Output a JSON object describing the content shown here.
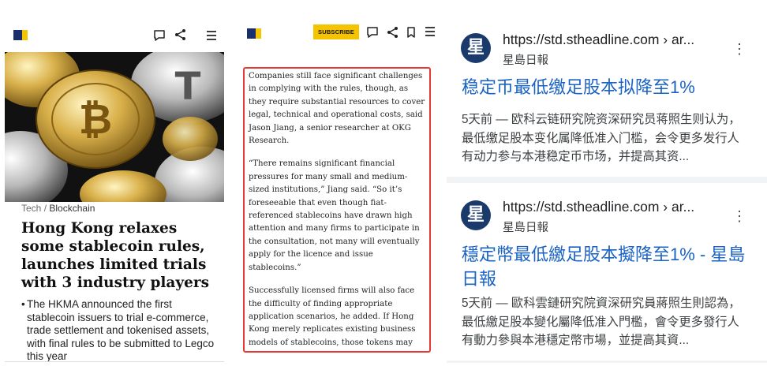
{
  "panel1": {
    "category": "Tech",
    "category_sep": " / ",
    "subcategory": "Blockchain",
    "headline": "Hong Kong relaxes some stablecoin rules, launches limited trials with 3 industry players",
    "bullet_mark": "•",
    "bullet": "The HKMA announced the first stablecoin issuers to trial e-commerce, trade settlement and tokenised assets, with final rules to be submitted to Legco this year",
    "icons": [
      "comment-icon",
      "share-icon",
      "menu-icon"
    ],
    "brand_colors": {
      "navy": "#1a2e6b",
      "yellow": "#f5c400"
    }
  },
  "panel2": {
    "subscribe_label": "SUBSCRIBE",
    "paragraphs": [
      "Companies still face significant challenges in complying with the rules, though, as they require substantial resources to cover legal, technical and operational costs, said Jason Jiang, a senior researcher at OKG Research.",
      "“There remains significant financial pressures for many small and medium-sized institutions,” Jiang said. “So it’s foreseeable that even though fiat-referenced stablecoins have drawn high attention and many firms to participate in the consultation, not many will eventually apply for the licence and issue stablecoins.”",
      "Successfully licensed firms will also face the difficulty of finding appropriate application scenarios, he added. If Hong Kong merely replicates existing business models of stablecoins, those tokens may have a hard time establishing a competitive advantage, according to Jiang."
    ],
    "highlight_color": "#e53935",
    "icons": [
      "comment-icon",
      "bookmark-icon",
      "menu-icon"
    ]
  },
  "panel3": {
    "results": [
      {
        "icon_glyph": "星",
        "url": "https://std.stheadline.com › ar...",
        "site": "星島日報",
        "title": "稳定币最低缴足股本拟降至1%",
        "snippet": "5天前 — 欧科云链研究院资深研究员蒋照生则认为，最低缴足股本变化属降低准入门槛，会令更多发行人有动力参与本港稳定币市场，并提高其资..."
      },
      {
        "icon_glyph": "星",
        "url": "https://std.stheadline.com › ar...",
        "site": "星島日報",
        "title": "穩定幣最低繳足股本擬降至1% - 星島日報",
        "snippet": "5天前 — 歐科雲鏈研究院資深研究員蔣照生則認為，最低繳足股本變化屬降低准入門檻，會令更多發行人有動力參與本港穩定幣市場，並提高其資..."
      }
    ],
    "kebab_glyph": "⋮",
    "link_color": "#1a63c5"
  }
}
